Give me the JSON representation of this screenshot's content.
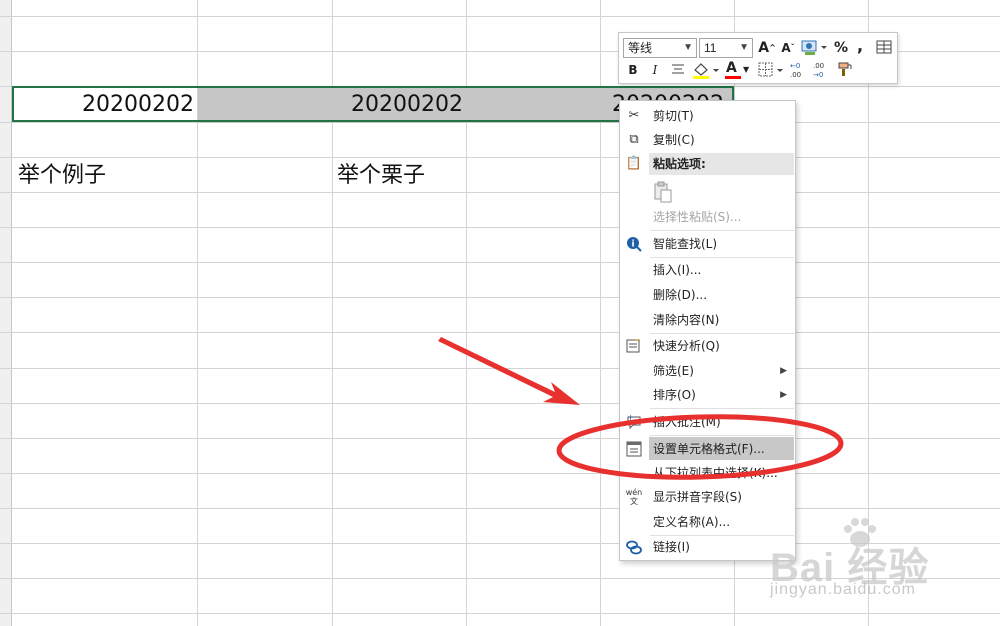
{
  "sheet": {
    "cells": {
      "a_row1": "20200202",
      "c_row1": "20200202",
      "e_row1": "20200202",
      "a_row3": "举个例子",
      "c_row3": "举个栗子"
    },
    "colors": {
      "grid": "#d4d4d4",
      "selection_border": "#217346",
      "selection_fill": "#c6c6c6"
    }
  },
  "mini_toolbar": {
    "font_name": "等线",
    "font_size": "11",
    "grow_font_glyph": "A",
    "shrink_font_glyph": "A",
    "percent_glyph": "%",
    "comma_glyph": ",",
    "bold_glyph": "B",
    "italic_glyph": "I",
    "font_color_glyph": "A",
    "font_color": "#ff0000",
    "fill_color": "#ffff00",
    "inc_decimal_text": "←0\n.00",
    "dec_decimal_text": ".00\n→0"
  },
  "context_menu": {
    "items": {
      "cut": "剪切(T)",
      "copy": "复制(C)",
      "paste_options": "粘贴选项:",
      "paste_special": "选择性粘贴(S)...",
      "smart_lookup": "智能查找(L)",
      "insert": "插入(I)...",
      "delete": "删除(D)...",
      "clear_contents": "清除内容(N)",
      "quick_analysis": "快速分析(Q)",
      "filter": "筛选(E)",
      "sort": "排序(O)",
      "insert_comment": "插入批注(M)",
      "format_cells": "设置单元格格式(F)...",
      "pick_from_list": "从下拉列表中选择(K)...",
      "show_phonetic": "显示拼音字段(S)",
      "define_name": "定义名称(A)...",
      "link": "链接(I)"
    },
    "highlight_color": "#c8c8c8"
  },
  "annotation": {
    "color": "#e8312e"
  },
  "watermark": {
    "brand": "Bai 经验",
    "url": "jingyan.baidu.com"
  }
}
